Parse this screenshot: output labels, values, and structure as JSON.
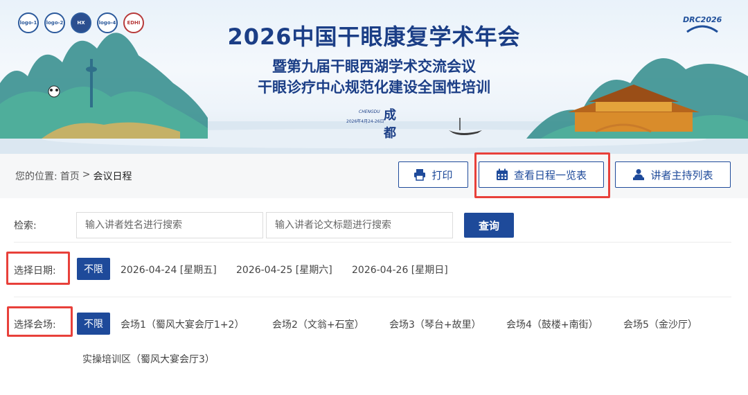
{
  "banner": {
    "logos": [
      "logo-1",
      "logo-2",
      "HX",
      "logo-4",
      "EDHI"
    ],
    "drc_logo": "DRC2026",
    "title": "2026中国干眼康复学术年会",
    "subtitle_1": "暨第九届干眼西湖学术交流会议",
    "subtitle_2": "干眼诊疗中心规范化建设全国性培训",
    "city_en": "CHENGDU",
    "city_cn": "成都",
    "date": "2026年4月24-26日"
  },
  "breadcrumb": {
    "prefix": "您的位置:",
    "home": "首页",
    "separator": ">",
    "current": "会议日程"
  },
  "toolbar": {
    "print_label": "打印",
    "schedule_label": "查看日程一览表",
    "speakers_label": "讲者主持列表"
  },
  "search": {
    "label": "检索:",
    "speaker_placeholder": "输入讲者姓名进行搜索",
    "title_placeholder": "输入讲者论文标题进行搜索",
    "query_label": "查询"
  },
  "date_filter": {
    "label": "选择日期:",
    "active": "不限",
    "options": [
      "2026-04-24 [星期五]",
      "2026-04-25 [星期六]",
      "2026-04-26 [星期日]"
    ]
  },
  "venue_filter": {
    "label": "选择会场:",
    "active": "不限",
    "options": [
      "会场1（蜀风大宴会厅1+2）",
      "会场2（文翁+石室）",
      "会场3（琴台+故里）",
      "会场4（鼓楼+南街）",
      "会场5（金沙厅）",
      "实操培训区（蜀风大宴会厅3）"
    ]
  },
  "colors": {
    "primary": "#1e4a9a",
    "highlight": "#e8403a",
    "title": "#1b3e86"
  },
  "icons": [
    "printer-icon",
    "calendar-icon",
    "speaker-icon"
  ]
}
